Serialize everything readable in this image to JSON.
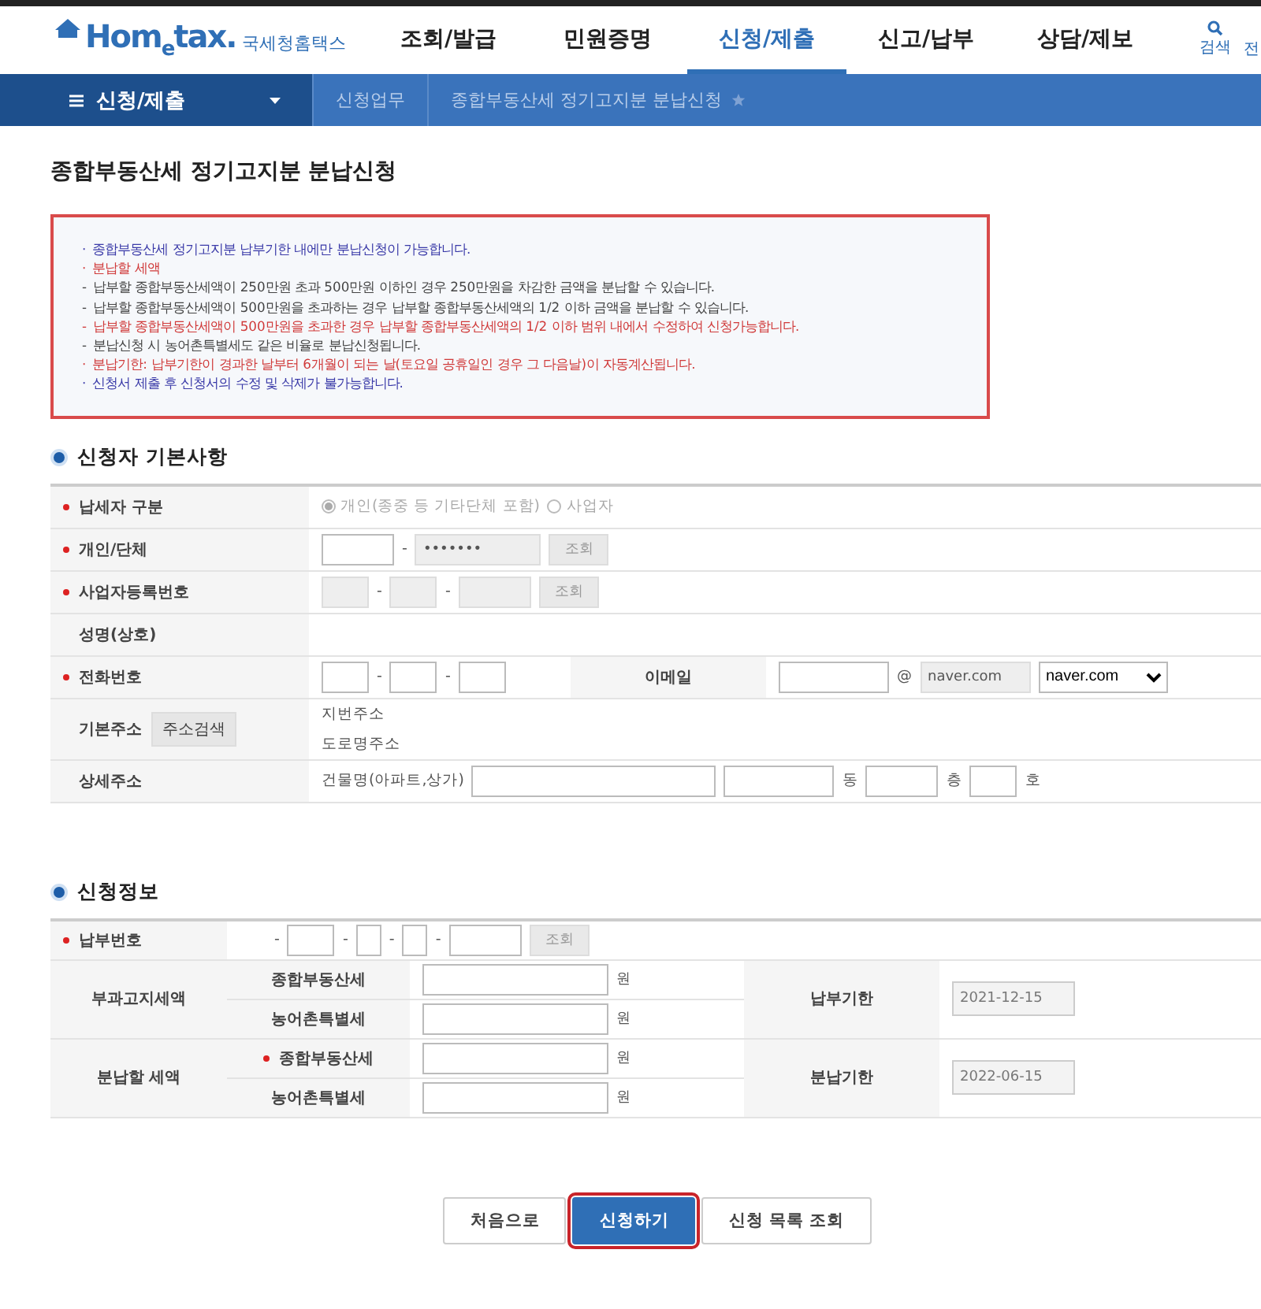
{
  "header": {
    "logo_text": "Hom$_{e}$tax.",
    "logo_subtitle": "국세청홈택스",
    "nav": [
      {
        "label": "조회/발급",
        "selected": false
      },
      {
        "label": "민원증명",
        "selected": false
      },
      {
        "label": "신청/제출",
        "selected": true
      },
      {
        "label": "신고/납부",
        "selected": false
      },
      {
        "label": "상담/제보",
        "selected": false
      }
    ],
    "search_label": "검색",
    "cut_label": "전"
  },
  "breadcrumb": {
    "menu": "신청/제출",
    "items": [
      "신청업무",
      "종합부동산세 정기고지분 분납신청"
    ]
  },
  "page_title": "종합부동산세 정기고지분 분납신청",
  "notices": [
    {
      "marker": "·",
      "text": "종합부동산세 정기고지분 납부기한 내에만 분납신청이 가능합니다.",
      "color": "#3a3aa8"
    },
    {
      "marker": "·",
      "text": "분납할 세액",
      "color": "#d03a3a"
    },
    {
      "marker": "-",
      "text": "납부할 종합부동산세액이 250만원 초과 500만원 이하인 경우 250만원을 차감한 금액을 분납할 수 있습니다.",
      "color": "#444444"
    },
    {
      "marker": "-",
      "text": "납부할 종합부동산세액이 500만원을 초과하는 경우 납부할 종합부동산세액의 1/2 이하 금액을 분납할 수 있습니다.",
      "color": "#444444"
    },
    {
      "marker": "-",
      "text": "납부할 종합부동산세액이 500만원을 초과한 경우 납부할 종합부동산세액의 1/2 이하 범위 내에서 수정하여 신청가능합니다.",
      "color": "#d03a3a"
    },
    {
      "marker": "-",
      "text": "분납신청 시 농어촌특별세도 같은 비율로 분납신청됩니다.",
      "color": "#444444"
    },
    {
      "marker": "·",
      "text": "분납기한: 납부기한이 경과한 날부터 6개월이 되는 날(토요일 공휴일인 경우 그 다음날)이 자동계산됩니다.",
      "color": "#d03a3a"
    },
    {
      "marker": "·",
      "text": "신청서 제출 후 신청서의 수정 및 삭제가 불가능합니다.",
      "color": "#3a3aa8"
    }
  ],
  "applicant": {
    "title": "신청자 기본사항",
    "rows": [
      {
        "label": "납세자 구분",
        "required": true,
        "parts": [
          {
            "kind": "radio",
            "label": "개인(종중 등 기타단체 포함)",
            "selected": true
          },
          {
            "kind": "radio",
            "label": "사업자",
            "selected": false
          }
        ]
      },
      {
        "label": "개인/단체",
        "required": true,
        "parts": [
          {
            "kind": "input",
            "disabled": false
          },
          {
            "kind": "text",
            "text": "-"
          },
          {
            "kind": "input",
            "value": "•••••••",
            "disabled": true
          },
          {
            "kind": "button",
            "label": "조회"
          }
        ]
      },
      {
        "label": "사업자등록번호",
        "required": true,
        "parts": [
          {
            "kind": "input",
            "disabled": true
          },
          {
            "kind": "text",
            "text": "-"
          },
          {
            "kind": "input",
            "disabled": true
          },
          {
            "kind": "text",
            "text": "-"
          },
          {
            "kind": "input",
            "disabled": true
          },
          {
            "kind": "button",
            "label": "조회"
          }
        ]
      },
      {
        "label": "성명(상호)",
        "required": false,
        "parts": []
      },
      {
        "label": "전화번호",
        "required": true,
        "parts": [
          {
            "kind": "input",
            "disabled": false
          },
          {
            "kind": "text",
            "text": "-"
          },
          {
            "kind": "input",
            "disabled": false
          },
          {
            "kind": "text",
            "text": "-"
          },
          {
            "kind": "input",
            "disabled": false
          }
        ],
        "second_label": "이메일",
        "second_parts": [
          {
            "kind": "input",
            "disabled": false
          },
          {
            "kind": "text",
            "text": "@"
          },
          {
            "kind": "input",
            "value": "naver.com",
            "disabled": true
          },
          {
            "kind": "select",
            "value": "naver.com"
          }
        ]
      },
      {
        "label": "기본주소",
        "required": false,
        "label_button": "주소검색",
        "parts": [
          {
            "kind": "lines",
            "lines": [
              "지번주소",
              "도로명주소"
            ]
          }
        ]
      },
      {
        "label": "상세주소",
        "required": false,
        "parts": [
          {
            "kind": "text",
            "text": "건물명(아파트,상가)"
          },
          {
            "kind": "input",
            "disabled": false
          },
          {
            "kind": "input",
            "disabled": false
          },
          {
            "kind": "text",
            "text": "동"
          },
          {
            "kind": "input",
            "disabled": false
          },
          {
            "kind": "text",
            "text": "층"
          },
          {
            "kind": "input",
            "disabled": false
          },
          {
            "kind": "text",
            "text": "호"
          }
        ]
      }
    ]
  },
  "application": {
    "title": "신청정보",
    "payment_no": {
      "label": "납부번호",
      "required": true,
      "parts": [
        {
          "kind": "text",
          "text": "-"
        },
        {
          "kind": "input",
          "disabled": false
        },
        {
          "kind": "text",
          "text": "-"
        },
        {
          "kind": "input",
          "disabled": false
        },
        {
          "kind": "text",
          "text": "-"
        },
        {
          "kind": "input",
          "disabled": false
        },
        {
          "kind": "text",
          "text": "-"
        },
        {
          "kind": "input",
          "disabled": false
        },
        {
          "kind": "button",
          "label": "조회"
        }
      ]
    },
    "groups": [
      {
        "label": "부과고지세액",
        "items": [
          {
            "label": "종합부동산세",
            "required": false,
            "unit": "원"
          },
          {
            "label": "농어촌특별세",
            "required": false,
            "unit": "원"
          }
        ],
        "side_label": "납부기한",
        "side_value": "2021-12-15"
      },
      {
        "label": "분납할 세액",
        "items": [
          {
            "label": "종합부동산세",
            "required": true,
            "unit": "원"
          },
          {
            "label": "농어촌특별세",
            "required": false,
            "unit": "원"
          }
        ],
        "side_label": "분납기한",
        "side_value": "2022-06-15"
      }
    ]
  },
  "buttons": [
    {
      "label": "처음으로",
      "kind": "default",
      "highlighted": false
    },
    {
      "label": "신청하기",
      "kind": "primary",
      "highlighted": true
    },
    {
      "label": "신청 목록 조회",
      "kind": "default",
      "highlighted": false
    }
  ]
}
